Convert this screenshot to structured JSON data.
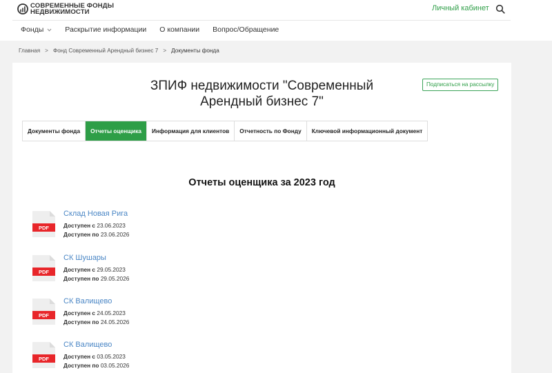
{
  "header": {
    "logo_line1": "СОВРЕМЕННЫЕ ФОНДЫ",
    "logo_line2": "НЕДВИЖИМОСТИ",
    "cabinet": "Личный кабинет",
    "nav": [
      "Фонды",
      "Раскрытие информации",
      "О компании",
      "Вопрос/Обращение"
    ]
  },
  "breadcrumb": {
    "items": [
      "Главная",
      "Фонд Современный Арендный бизнес 7",
      "Документы фонда"
    ],
    "sep": ">"
  },
  "page": {
    "title": "ЗПИФ недвижимости \"Современный Арендный бизнес 7\"",
    "subscribe": "Подписаться на рассылку",
    "tabs": [
      "Документы фонда",
      "Отчеты оценщика",
      "Информация для клиентов",
      "Отчетность по Фонду",
      "Ключевой информационный документ"
    ],
    "section_title": "Отчеты оценщика за 2023 год",
    "available_from_label": "Доступен с",
    "available_to_label": "Доступен по",
    "pdf_label": "PDF"
  },
  "documents": [
    {
      "name": "Склад Новая Рига",
      "from": "23.06.2023",
      "to": "23.06.2026"
    },
    {
      "name": "СК Шушары",
      "from": "29.05.2023",
      "to": "29.05.2026"
    },
    {
      "name": "СК Валищево",
      "from": "24.05.2023",
      "to": "24.05.2026"
    },
    {
      "name": "СК Валищево",
      "from": "03.05.2023",
      "to": "03.05.2026"
    }
  ],
  "colors": {
    "accent": "#2e9e47",
    "link": "#4a86c5",
    "pdf_red": "#e8262a"
  }
}
